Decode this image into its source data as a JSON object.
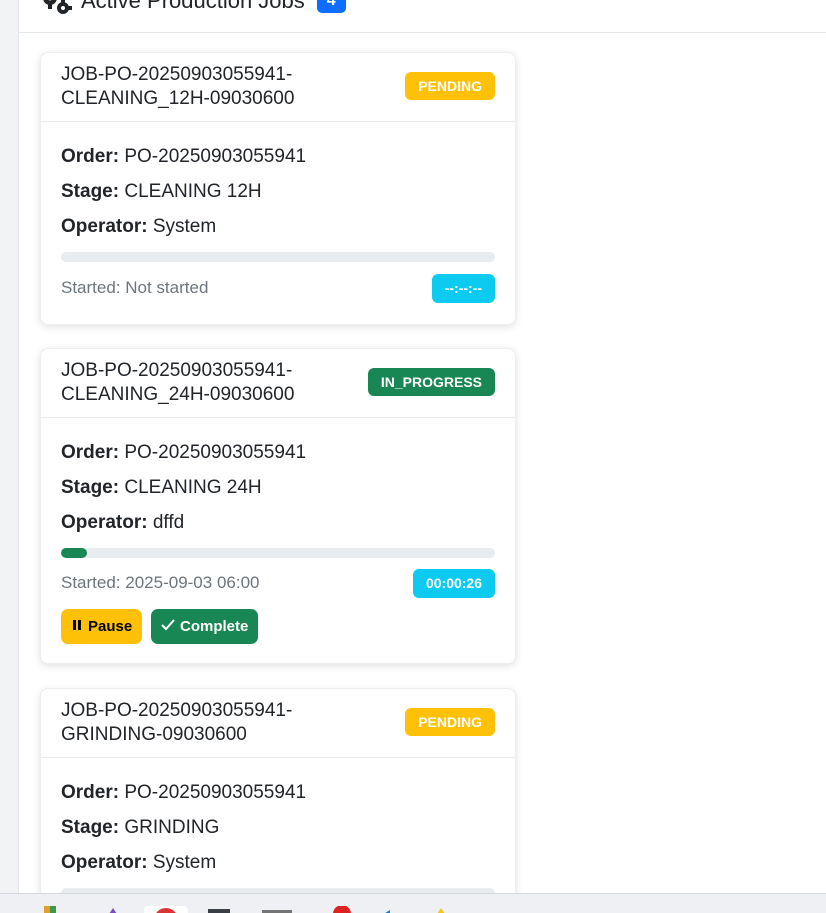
{
  "header": {
    "title": "Active Production Jobs",
    "count": "4"
  },
  "jobs": [
    {
      "id": "JOB-PO-20250903055941-CLEANING_12H-09030600",
      "status": "PENDING",
      "order_label": "Order:",
      "order": "PO-20250903055941",
      "stage_label": "Stage:",
      "stage": "CLEANING 12H",
      "operator_label": "Operator:",
      "operator": "System",
      "progress_percent": 0,
      "started": "Started: Not started",
      "timer": "--:--:--"
    },
    {
      "id": "JOB-PO-20250903055941-CLEANING_24H-09030600",
      "status": "IN_PROGRESS",
      "order_label": "Order:",
      "order": "PO-20250903055941",
      "stage_label": "Stage:",
      "stage": "CLEANING 24H",
      "operator_label": "Operator:",
      "operator": "dffd",
      "progress_percent": 6,
      "progress_text": "6%",
      "started": "Started: 2025-09-03 06:00",
      "timer": "00:00:26",
      "pause_label": "Pause",
      "complete_label": "Complete"
    },
    {
      "id": "JOB-PO-20250903055941-GRINDING-09030600",
      "status": "PENDING",
      "order_label": "Order:",
      "order": "PO-20250903055941",
      "stage_label": "Stage:",
      "stage": "GRINDING",
      "operator_label": "Operator:",
      "operator": "System"
    }
  ],
  "colors": {
    "pending": "#ffc107",
    "in_progress": "#198754",
    "timer": "#0dcaf0",
    "count_badge": "#0d6efd"
  },
  "icons": {
    "header": "gears-icon",
    "pause": "pause-icon",
    "complete": "check-icon"
  }
}
